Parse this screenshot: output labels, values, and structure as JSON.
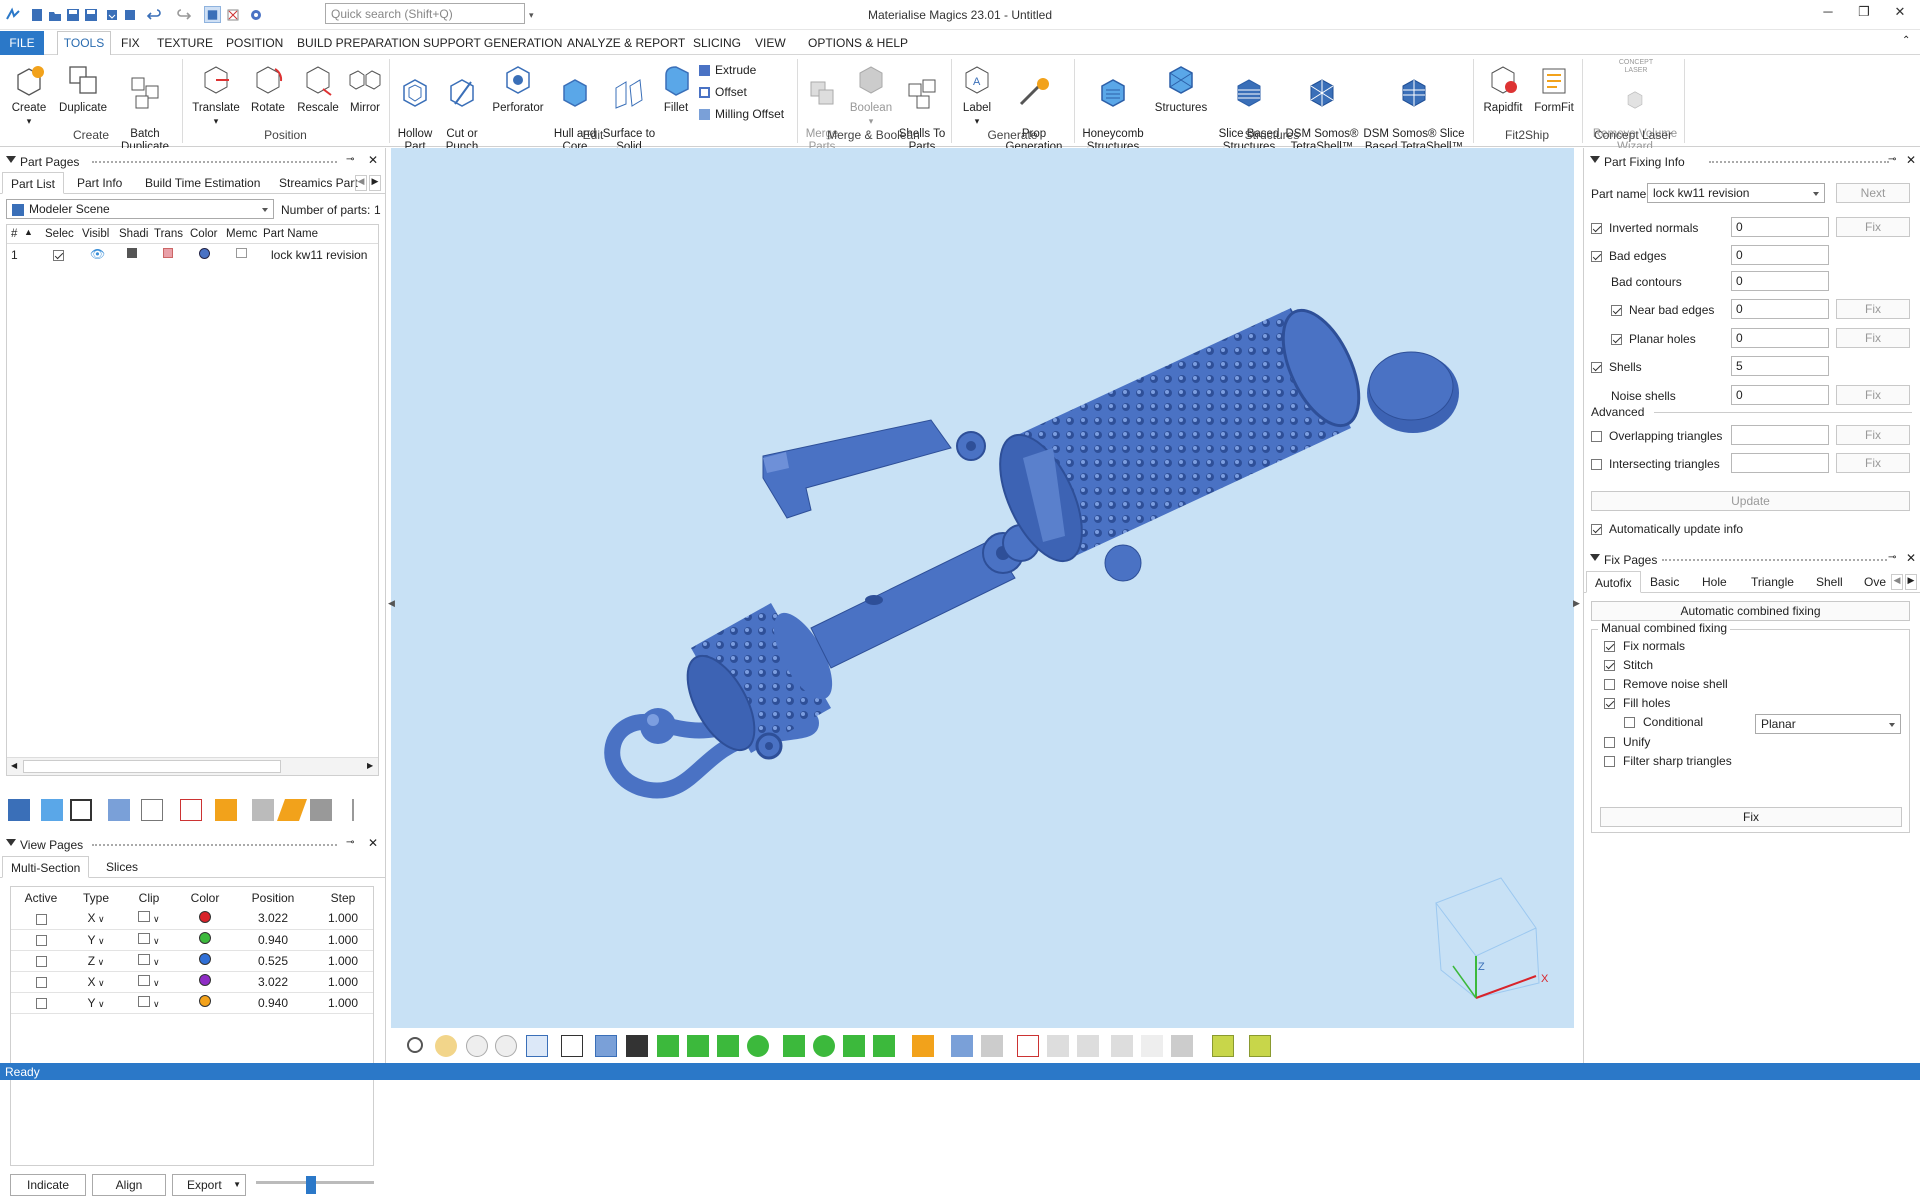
{
  "app": {
    "title": "Materialise Magics 23.01 - Untitled"
  },
  "quick_access": {
    "search_placeholder": "Quick search (Shift+Q)"
  },
  "menu_tabs": [
    "TOOLS",
    "FIX",
    "TEXTURE",
    "POSITION",
    "BUILD PREPARATION",
    "SUPPORT GENERATION",
    "ANALYZE & REPORT",
    "SLICING",
    "VIEW",
    "OPTIONS & HELP"
  ],
  "file_tab": "FILE",
  "ribbon": {
    "create": {
      "create": "Create",
      "duplicate": "Duplicate",
      "batch": "Batch\nDuplicate",
      "label": "Create"
    },
    "position": {
      "translate": "Translate",
      "rotate": "Rotate",
      "rescale": "Rescale",
      "mirror": "Mirror",
      "label": "Position"
    },
    "edit": {
      "hollow": "Hollow\nPart",
      "cut": "Cut or\nPunch",
      "perforator": "Perforator",
      "hull": "Hull and\nCore",
      "surface": "Surface to\nSolid",
      "fillet": "Fillet",
      "extrude": "Extrude",
      "offset": "Offset",
      "milling": "Milling Offset",
      "label": "Edit"
    },
    "merge": {
      "merge": "Merge\nParts",
      "boolean": "Boolean",
      "shells": "Shells To\nParts",
      "label": "Merge & Boolean"
    },
    "generate": {
      "label_btn": "Label",
      "prop": "Prop\nGeneration",
      "label": "Generate"
    },
    "structures": {
      "honeycomb": "Honeycomb\nStructures",
      "structures": "Structures",
      "slice": "Slice Based\nStructures",
      "dsm1": "DSM Somos®\nTetraShell™",
      "dsm2": "DSM Somos® Slice\nBased TetraShell™",
      "label": "Structures"
    },
    "fit2ship": {
      "rapidfit": "Rapidfit",
      "formfit": "FormFit",
      "label": "Fit2Ship"
    },
    "concept": {
      "remove": "Remove Volume\nWizard",
      "logo": "CONCEPT\nLASER",
      "label": "Concept Laser"
    }
  },
  "part_pages": {
    "title": "Part Pages",
    "tabs": [
      "Part List",
      "Part Info",
      "Build Time Estimation",
      "Streamics Part"
    ],
    "scene": "Modeler Scene",
    "num_parts_label": "Number of parts:",
    "num_parts": "1",
    "columns": [
      "#",
      "Selec",
      "Visibl",
      "Shadi",
      "Trans",
      "Color",
      "Memc",
      "Part Name"
    ],
    "rows": [
      {
        "num": "1",
        "name": "lock kw11 revision"
      }
    ]
  },
  "view_pages": {
    "title": "View Pages",
    "tabs": [
      "Multi-Section",
      "Slices"
    ],
    "columns": [
      "Active",
      "Type",
      "Clip",
      "Color",
      "Position",
      "Step"
    ],
    "rows": [
      {
        "type": "X",
        "color": "#d9232a",
        "position": "3.022",
        "step": "1.000"
      },
      {
        "type": "Y",
        "color": "#3cb93c",
        "position": "0.940",
        "step": "1.000"
      },
      {
        "type": "Z",
        "color": "#2f6fd6",
        "position": "0.525",
        "step": "1.000"
      },
      {
        "type": "X",
        "color": "#8e2cc4",
        "position": "3.022",
        "step": "1.000"
      },
      {
        "type": "Y",
        "color": "#f3a21b",
        "position": "0.940",
        "step": "1.000"
      }
    ],
    "buttons": [
      "Indicate",
      "Align",
      "Export"
    ]
  },
  "part_fixing": {
    "title": "Part Fixing Info",
    "part_name_label": "Part name",
    "part_name": "lock kw11 revision",
    "next": "Next",
    "rows": [
      {
        "label": "Inverted normals",
        "value": "0",
        "checked": true,
        "fix": true
      },
      {
        "label": "Bad edges",
        "value": "0",
        "checked": true,
        "fix": false
      },
      {
        "label": "Bad contours",
        "value": "0",
        "checked": null,
        "fix": false
      },
      {
        "label": "Near bad edges",
        "value": "0",
        "checked": true,
        "fix": true
      },
      {
        "label": "Planar holes",
        "value": "0",
        "checked": true,
        "fix": true
      },
      {
        "label": "Shells",
        "value": "5",
        "checked": true,
        "fix": false
      },
      {
        "label": "Noise shells",
        "value": "0",
        "checked": null,
        "fix": true
      }
    ],
    "advanced": "Advanced",
    "overlapping": "Overlapping triangles",
    "intersecting": "Intersecting triangles",
    "fix_label": "Fix",
    "update": "Update",
    "auto_update": "Automatically update info"
  },
  "fix_pages": {
    "title": "Fix Pages",
    "tabs": [
      "Autofix",
      "Basic",
      "Hole",
      "Triangle",
      "Shell",
      "Over"
    ],
    "auto_combined": "Automatic combined fixing",
    "manual_title": "Manual combined fixing",
    "options": [
      {
        "label": "Fix normals",
        "checked": true
      },
      {
        "label": "Stitch",
        "checked": true
      },
      {
        "label": "Remove noise shell",
        "checked": false
      },
      {
        "label": "Fill holes",
        "checked": true
      },
      {
        "label": "Conditional",
        "checked": false
      },
      {
        "label": "Unify",
        "checked": false
      },
      {
        "label": "Filter sharp triangles",
        "checked": false
      }
    ],
    "fill_mode": "Planar",
    "fix": "Fix"
  },
  "status": {
    "text": "Ready"
  },
  "colors": {
    "accent": "#2b78c8",
    "viewport": "#c8e1f5",
    "model": "#4a72c4"
  }
}
